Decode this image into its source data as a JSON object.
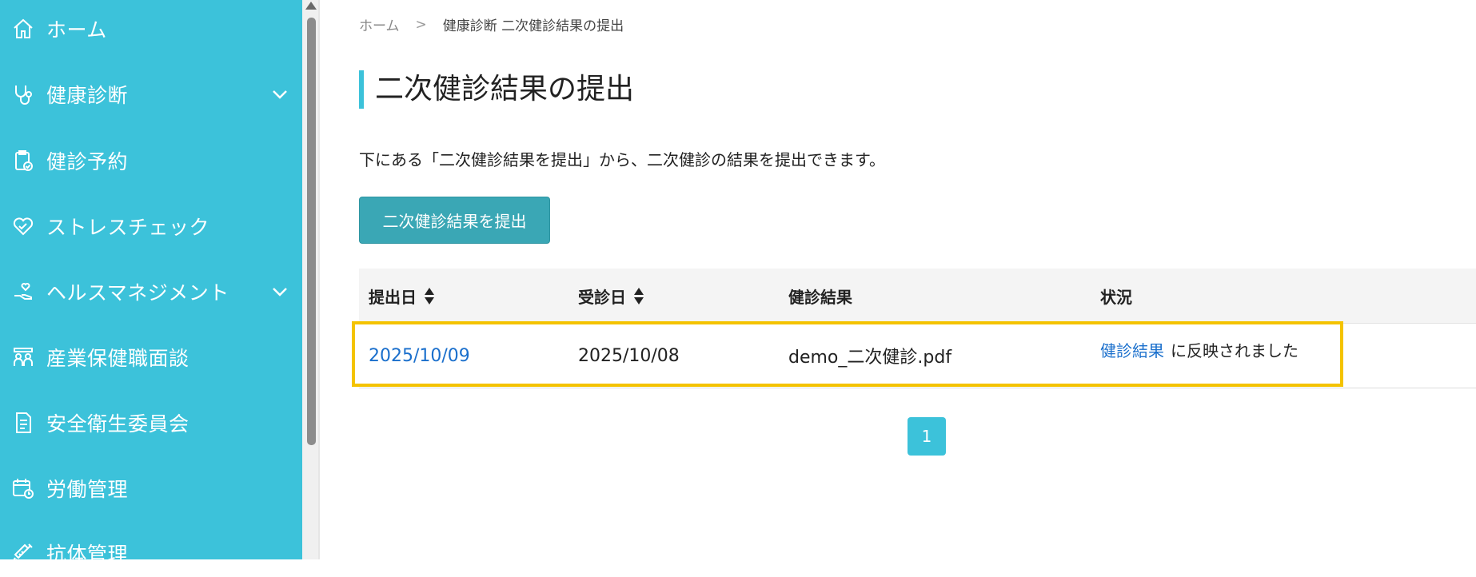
{
  "sidebar": {
    "items": [
      {
        "label": "ホーム",
        "icon": "home-icon",
        "has_chevron": false
      },
      {
        "label": "健康診断",
        "icon": "stethoscope-icon",
        "has_chevron": true
      },
      {
        "label": "健診予約",
        "icon": "clipboard-check-icon",
        "has_chevron": false
      },
      {
        "label": "ストレスチェック",
        "icon": "heart-icon",
        "has_chevron": false
      },
      {
        "label": "ヘルスマネジメント",
        "icon": "hand-heart-icon",
        "has_chevron": true
      },
      {
        "label": "産業保健職面談",
        "icon": "consultation-icon",
        "has_chevron": false
      },
      {
        "label": "安全衛生委員会",
        "icon": "document-icon",
        "has_chevron": false
      },
      {
        "label": "労働管理",
        "icon": "calendar-clock-icon",
        "has_chevron": false
      },
      {
        "label": "抗体管理",
        "icon": "syringe-icon",
        "has_chevron": false
      }
    ]
  },
  "breadcrumb": {
    "home": "ホーム",
    "separator": ">",
    "current": "健康診断 二次健診結果の提出"
  },
  "page": {
    "title": "二次健診結果の提出",
    "description": "下にある「二次健診結果を提出」から、二次健診の結果を提出できます。",
    "submit_button": "二次健診結果を提出"
  },
  "table": {
    "headers": {
      "submitted_date": "提出日",
      "exam_date": "受診日",
      "result": "健診結果",
      "status": "状況"
    },
    "rows": [
      {
        "submitted_date": "2025/10/09",
        "exam_date": "2025/10/08",
        "result": "demo_二次健診.pdf",
        "status_link": "健診結果",
        "status_text": "に反映されました"
      }
    ]
  },
  "pagination": {
    "current_page": "1"
  },
  "colors": {
    "sidebar_bg": "#3cc2da",
    "button_bg": "#3aa7b5",
    "link": "#1a6fcc",
    "highlight_border": "#f4c300"
  }
}
